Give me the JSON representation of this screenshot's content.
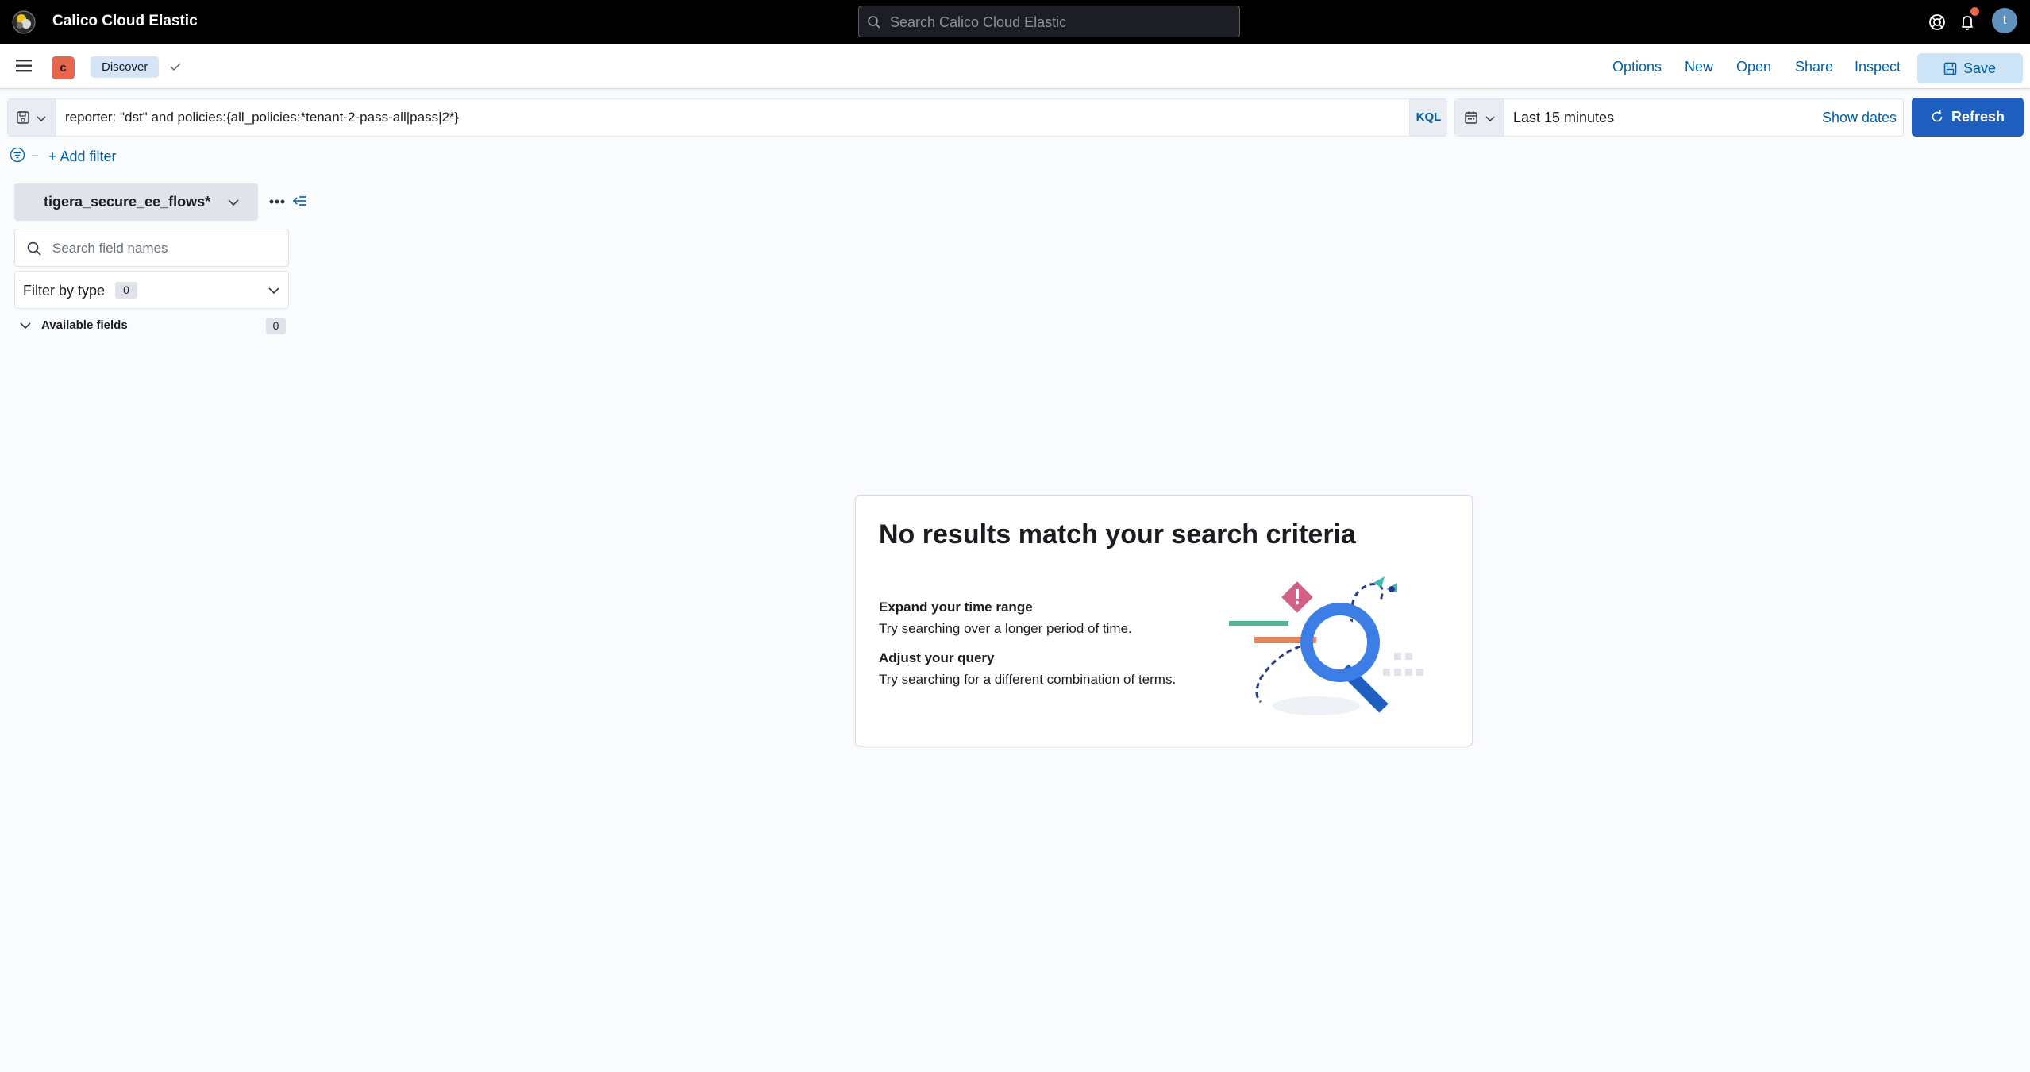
{
  "header": {
    "app_title": "Calico Cloud Elastic",
    "search_placeholder": "Search Calico Cloud Elastic",
    "icons": [
      "elastic-logo-icon",
      "help-icon",
      "notifications-icon"
    ],
    "avatar_initial": "t"
  },
  "subbar": {
    "space_initial": "c",
    "breadcrumb": "Discover",
    "nav": {
      "options": "Options",
      "new": "New",
      "open": "Open",
      "share": "Share",
      "inspect": "Inspect",
      "save": "Save"
    }
  },
  "query": {
    "text": "reporter: \"dst\" and policies:{all_policies:*tenant-2-pass-all|pass|2*}",
    "language": "KQL"
  },
  "date_picker": {
    "range": "Last 15 minutes",
    "show_dates": "Show dates",
    "refresh": "Refresh"
  },
  "filters": {
    "add_filter": "+ Add filter"
  },
  "sidebar": {
    "index_pattern": "tigera_secure_ee_flows*",
    "field_search_placeholder": "Search field names",
    "filter_by_type": "Filter by type",
    "filter_by_type_count": "0",
    "available_fields": "Available fields",
    "available_fields_count": "0"
  },
  "no_results": {
    "title": "No results match your search criteria",
    "tips": [
      {
        "heading": "Expand your time range",
        "body": "Try searching over a longer period of time."
      },
      {
        "heading": "Adjust your query",
        "body": "Try searching for a different combination of terms."
      }
    ]
  },
  "colors": {
    "header_bg": "#000000",
    "link": "#0061a6",
    "primary_button": "#1e5fbf",
    "space_badge": "#e7664c",
    "breadcrumb_bg": "#d6e4f7"
  }
}
